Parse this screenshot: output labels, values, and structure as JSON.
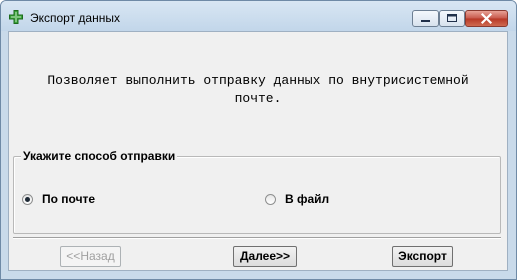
{
  "window": {
    "title": "Экспорт данных",
    "icon": "green-cross-app-icon",
    "controls": [
      "minimize-icon",
      "maximize-icon",
      "close-icon"
    ]
  },
  "description": {
    "line1": "Позволяет выполнить отправку данных по внутрисистемной",
    "line2": "почте."
  },
  "send_method": {
    "legend": "Укажите способ отправки",
    "options": [
      {
        "label": "По почте",
        "checked": true
      },
      {
        "label": "В файл",
        "checked": false
      }
    ]
  },
  "buttons": {
    "back": "<<Назад",
    "next": "Далее>>",
    "export": "Экспорт"
  }
}
